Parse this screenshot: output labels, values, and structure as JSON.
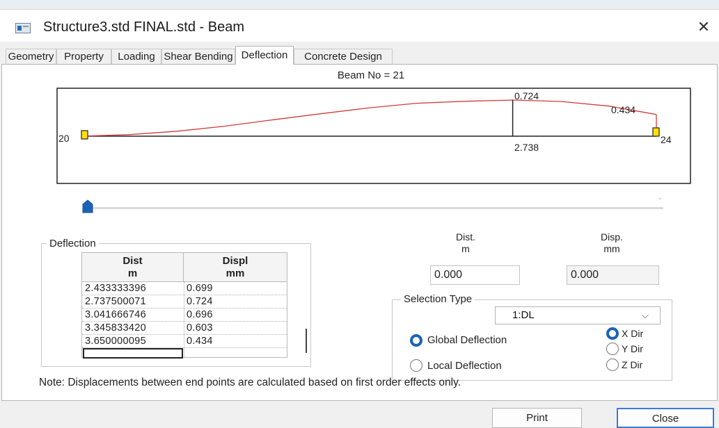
{
  "window": {
    "title": "Structure3.std FINAL.std - Beam",
    "close_glyph": "✕"
  },
  "tabs": [
    {
      "label": "Geometry",
      "active": false
    },
    {
      "label": "Property",
      "active": false
    },
    {
      "label": "Loading",
      "active": false
    },
    {
      "label": "Shear Bending",
      "active": false
    },
    {
      "label": "Deflection",
      "active": true
    },
    {
      "label": "Concrete Design",
      "active": false
    }
  ],
  "beam": {
    "label": "Beam No = 21",
    "start_node": "20",
    "end_node": "24",
    "max_label": "0.724",
    "max_position_label": "2.738",
    "end_label": "0.434"
  },
  "chart_data": {
    "type": "line",
    "x": [
      0.0,
      0.3,
      0.61,
      0.91,
      1.22,
      1.52,
      1.83,
      2.13,
      2.43,
      2.74,
      3.04,
      3.35,
      3.65
    ],
    "y": [
      0.0,
      0.03,
      0.1,
      0.2,
      0.33,
      0.45,
      0.57,
      0.66,
      0.699,
      0.724,
      0.696,
      0.603,
      0.434
    ],
    "series_color": "#d23a3a",
    "max_point": {
      "x": 2.738,
      "y": 0.724
    }
  },
  "slider": {
    "position": 0.0
  },
  "deflection_group": {
    "title": "Deflection",
    "columns": [
      {
        "line1": "Dist",
        "line2": "m"
      },
      {
        "line1": "Displ",
        "line2": "mm"
      }
    ],
    "rows": [
      {
        "dist": "2.433333396",
        "displ": "0.699"
      },
      {
        "dist": "2.737500071",
        "displ": "0.724"
      },
      {
        "dist": "3.041666746",
        "displ": "0.696"
      },
      {
        "dist": "3.345833420",
        "displ": "0.603"
      },
      {
        "dist": "3.650000095",
        "displ": "0.434"
      }
    ]
  },
  "readout": {
    "dist_label_line1": "Dist.",
    "dist_label_line2": "m",
    "disp_label_line1": "Disp.",
    "disp_label_line2": "mm",
    "dist_value": "0.000",
    "disp_value": "0.000"
  },
  "selection_type": {
    "title": "Selection Type",
    "load_case": "1:DL",
    "global_label": "Global Deflection",
    "local_label": "Local Deflection",
    "x_dir": "X Dir",
    "y_dir": "Y Dir",
    "z_dir": "Z Dir",
    "global_selected": true,
    "direction_selected": "X"
  },
  "note": "Note: Displacements between end points are calculated based on first order effects only.",
  "buttons": {
    "print": "Print",
    "close": "Close"
  },
  "colors": {
    "accent": "#1c63b7",
    "deflection_line": "#d23a3a",
    "support": "#ffe100"
  }
}
